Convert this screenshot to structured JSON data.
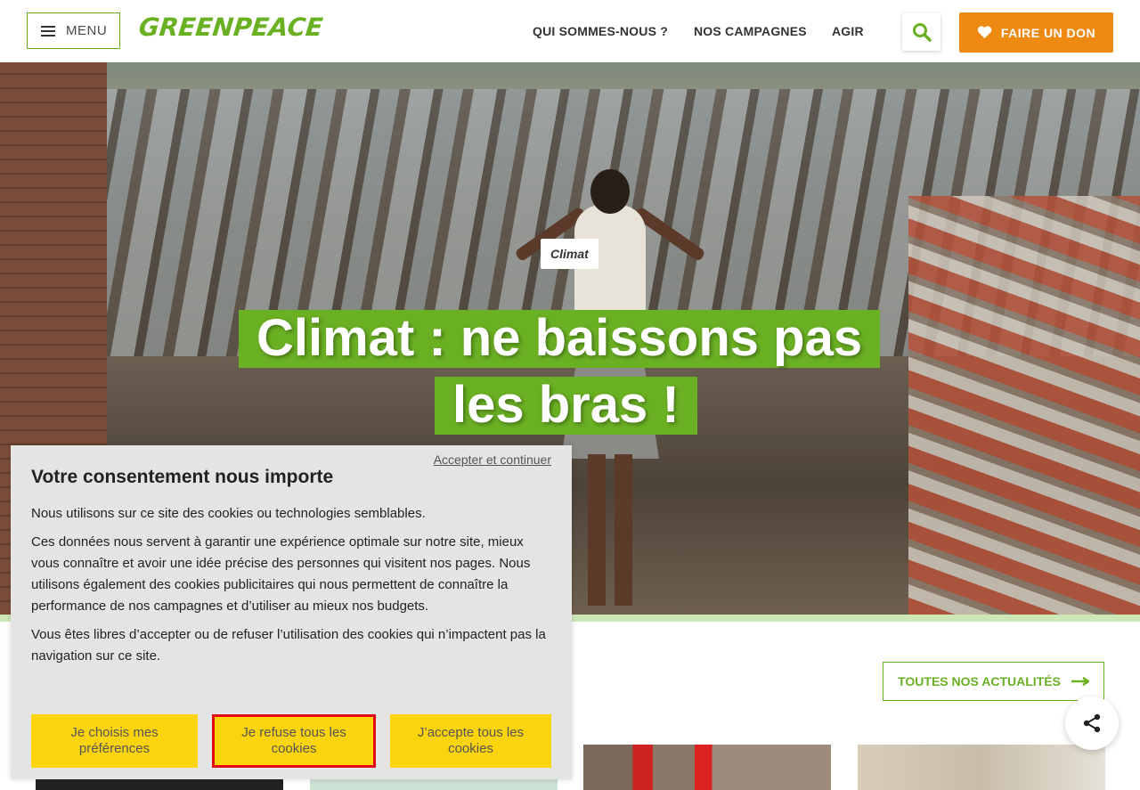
{
  "header": {
    "menu_label": "MENU",
    "logo_text": "GREENPEACE",
    "nav": [
      "QUI SOMMES-NOUS ?",
      "NOS CAMPAGNES",
      "AGIR"
    ],
    "donate_label": "FAIRE UN DON",
    "search_icon": "search-icon",
    "heart_icon": "heart-icon"
  },
  "hero": {
    "tag": "Climat",
    "title_line1": "Climat : ne baissons pas",
    "title_line2": "les bras !"
  },
  "news": {
    "all_news_label": "TOUTES NOS ACTUALITÉS"
  },
  "consent": {
    "accept_continue": "Accepter et continuer",
    "title": "Votre consentement nous importe",
    "p1": "Nous utilisons sur ce site des cookies ou technologies semblables.",
    "p2": "Ces données nous servent à garantir une expérience optimale sur notre site, mieux vous connaître et avoir une idée précise des personnes qui visitent nos pages. Nous utilisons également des cookies publicitaires qui nous permettent de connaître la performance de nos campagnes et d’utiliser au mieux nos budgets.",
    "p3": "Vous êtes libres d’accepter ou de refuser l’utilisation des cookies qui n’impactent pas la navigation sur ce site.",
    "btn_prefs": "Je choisis mes préférences",
    "btn_refuse": "Je refuse tous les cookies",
    "btn_accept": "J’accepte tous les cookies"
  },
  "colors": {
    "brand_green": "#6ab023",
    "donate_orange": "#ee8a12",
    "consent_button_yellow": "#fbd40d",
    "focus_red": "#e30613"
  }
}
